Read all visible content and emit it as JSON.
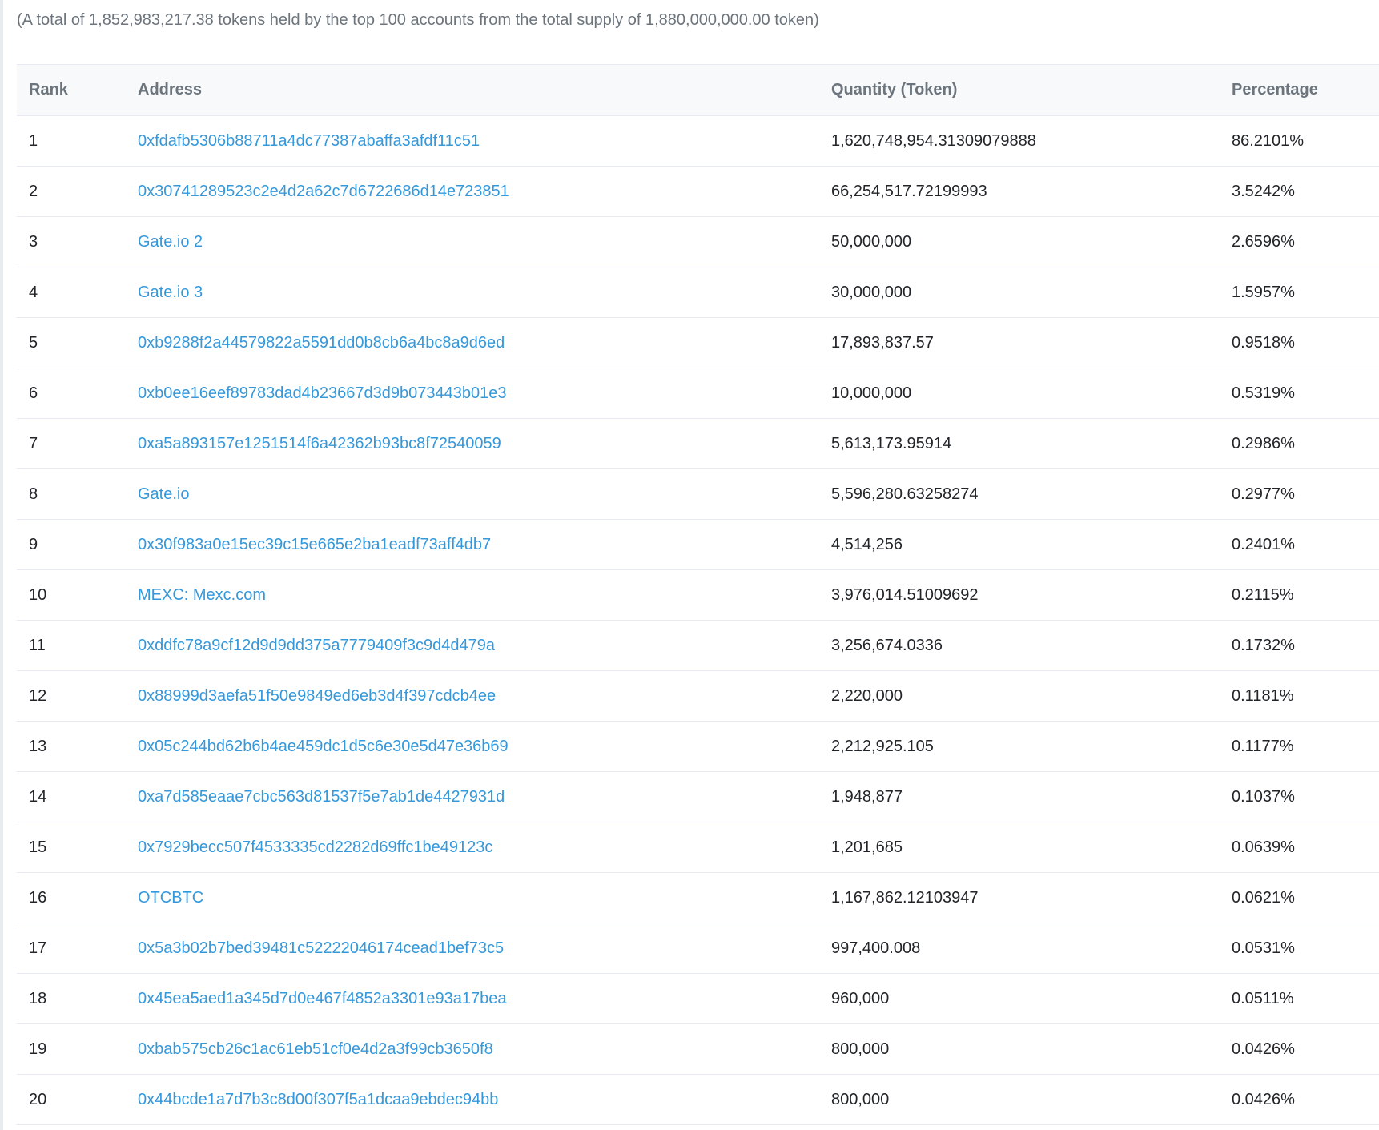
{
  "summary_text": "(A total of 1,852,983,217.38 tokens held by the top 100 accounts from the total supply of 1,880,000,000.00 token)",
  "table": {
    "headers": {
      "rank": "Rank",
      "address": "Address",
      "quantity": "Quantity (Token)",
      "percentage": "Percentage"
    },
    "rows": [
      {
        "rank": "1",
        "address": "0xfdafb5306b88711a4dc77387abaffa3afdf11c51",
        "quantity": "1,620,748,954.31309079888",
        "percentage": "86.2101%"
      },
      {
        "rank": "2",
        "address": "0x30741289523c2e4d2a62c7d6722686d14e723851",
        "quantity": "66,254,517.72199993",
        "percentage": "3.5242%"
      },
      {
        "rank": "3",
        "address": "Gate.io 2",
        "quantity": "50,000,000",
        "percentage": "2.6596%"
      },
      {
        "rank": "4",
        "address": "Gate.io 3",
        "quantity": "30,000,000",
        "percentage": "1.5957%"
      },
      {
        "rank": "5",
        "address": "0xb9288f2a44579822a5591dd0b8cb6a4bc8a9d6ed",
        "quantity": "17,893,837.57",
        "percentage": "0.9518%"
      },
      {
        "rank": "6",
        "address": "0xb0ee16eef89783dad4b23667d3d9b073443b01e3",
        "quantity": "10,000,000",
        "percentage": "0.5319%"
      },
      {
        "rank": "7",
        "address": "0xa5a893157e1251514f6a42362b93bc8f72540059",
        "quantity": "5,613,173.95914",
        "percentage": "0.2986%"
      },
      {
        "rank": "8",
        "address": "Gate.io",
        "quantity": "5,596,280.63258274",
        "percentage": "0.2977%"
      },
      {
        "rank": "9",
        "address": "0x30f983a0e15ec39c15e665e2ba1eadf73aff4db7",
        "quantity": "4,514,256",
        "percentage": "0.2401%"
      },
      {
        "rank": "10",
        "address": "MEXC: Mexc.com",
        "quantity": "3,976,014.51009692",
        "percentage": "0.2115%"
      },
      {
        "rank": "11",
        "address": "0xddfc78a9cf12d9d9dd375a7779409f3c9d4d479a",
        "quantity": "3,256,674.0336",
        "percentage": "0.1732%"
      },
      {
        "rank": "12",
        "address": "0x88999d3aefa51f50e9849ed6eb3d4f397cdcb4ee",
        "quantity": "2,220,000",
        "percentage": "0.1181%"
      },
      {
        "rank": "13",
        "address": "0x05c244bd62b6b4ae459dc1d5c6e30e5d47e36b69",
        "quantity": "2,212,925.105",
        "percentage": "0.1177%"
      },
      {
        "rank": "14",
        "address": "0xa7d585eaae7cbc563d81537f5e7ab1de4427931d",
        "quantity": "1,948,877",
        "percentage": "0.1037%"
      },
      {
        "rank": "15",
        "address": "0x7929becc507f4533335cd2282d69ffc1be49123c",
        "quantity": "1,201,685",
        "percentage": "0.0639%"
      },
      {
        "rank": "16",
        "address": "OTCBTC",
        "quantity": "1,167,862.12103947",
        "percentage": "0.0621%"
      },
      {
        "rank": "17",
        "address": "0x5a3b02b7bed39481c52222046174cead1bef73c5",
        "quantity": "997,400.008",
        "percentage": "0.0531%"
      },
      {
        "rank": "18",
        "address": "0x45ea5aed1a345d7d0e467f4852a3301e93a17bea",
        "quantity": "960,000",
        "percentage": "0.0511%"
      },
      {
        "rank": "19",
        "address": "0xbab575cb26c1ac61eb51cf0e4d2a3f99cb3650f8",
        "quantity": "800,000",
        "percentage": "0.0426%"
      },
      {
        "rank": "20",
        "address": "0x44bcde1a7d7b3c8d00f307f5a1dcaa9ebdec94bb",
        "quantity": "800,000",
        "percentage": "0.0426%"
      }
    ]
  },
  "colors": {
    "link": "#3498db",
    "header_bg": "#f8f9fa",
    "muted_text": "#6c757d",
    "row_border": "#e7eaf3"
  }
}
